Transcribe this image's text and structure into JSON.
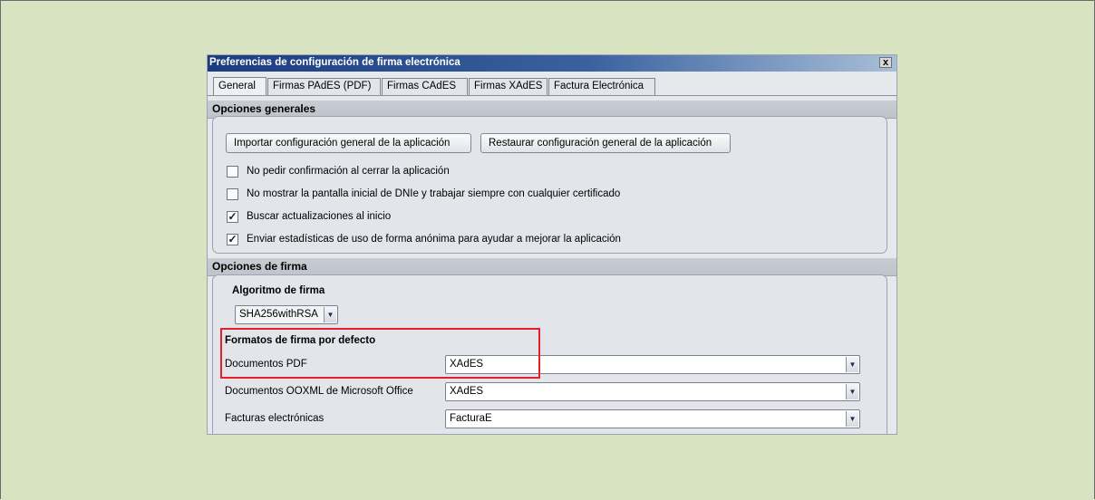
{
  "window": {
    "title": "Preferencias de configuración de firma electrónica",
    "close_label": "x"
  },
  "tabs": [
    {
      "label": "General",
      "active": true
    },
    {
      "label": "Firmas PAdES (PDF)",
      "active": false
    },
    {
      "label": "Firmas CAdES",
      "active": false
    },
    {
      "label": "Firmas XAdES",
      "active": false
    },
    {
      "label": "Factura Electrónica",
      "active": false
    }
  ],
  "general_options": {
    "header": "Opciones generales",
    "import_button": "Importar configuración general de la aplicación",
    "restore_button": "Restaurar configuración general de la aplicación",
    "checkboxes": [
      {
        "label": "No pedir confirmación al cerrar la aplicación",
        "checked": false
      },
      {
        "label": "No mostrar la pantalla inicial de DNIe y trabajar siempre con cualquier certificado",
        "checked": false
      },
      {
        "label": "Buscar actualizaciones al inicio",
        "checked": true
      },
      {
        "label": "Enviar estadísticas de uso de forma anónima para ayudar a mejorar la aplicación",
        "checked": true
      }
    ]
  },
  "signature_options": {
    "header": "Opciones de firma",
    "algorithm_label": "Algoritmo de firma",
    "algorithm_value": "SHA256withRSA",
    "default_formats_label": "Formatos de firma por defecto",
    "formats": [
      {
        "label": "Documentos PDF",
        "value": "XAdES"
      },
      {
        "label": "Documentos OOXML de Microsoft Office",
        "value": "XAdES"
      },
      {
        "label": "Facturas electrónicas",
        "value": "FacturaE"
      }
    ]
  },
  "colors": {
    "background": "#d7e3c1",
    "titlebar": "#1c3c80",
    "highlight": "#e5202a"
  },
  "icons": {
    "checked": "check-mark",
    "dropdown": "down-triangle"
  }
}
